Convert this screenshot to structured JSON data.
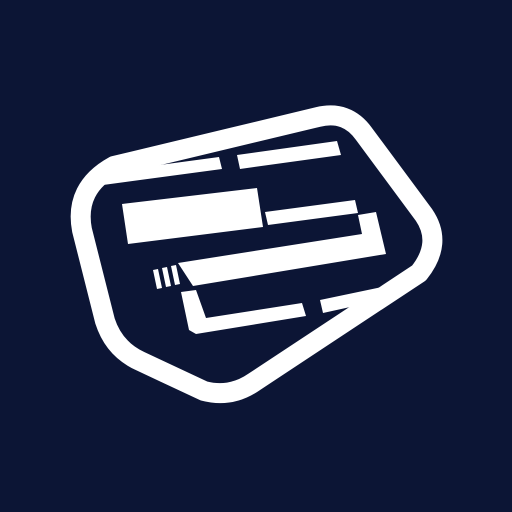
{
  "colors": {
    "background": "#0c1535",
    "foreground": "#ffffff"
  },
  "icon": {
    "name": "card-cigarette-logo-icon"
  }
}
